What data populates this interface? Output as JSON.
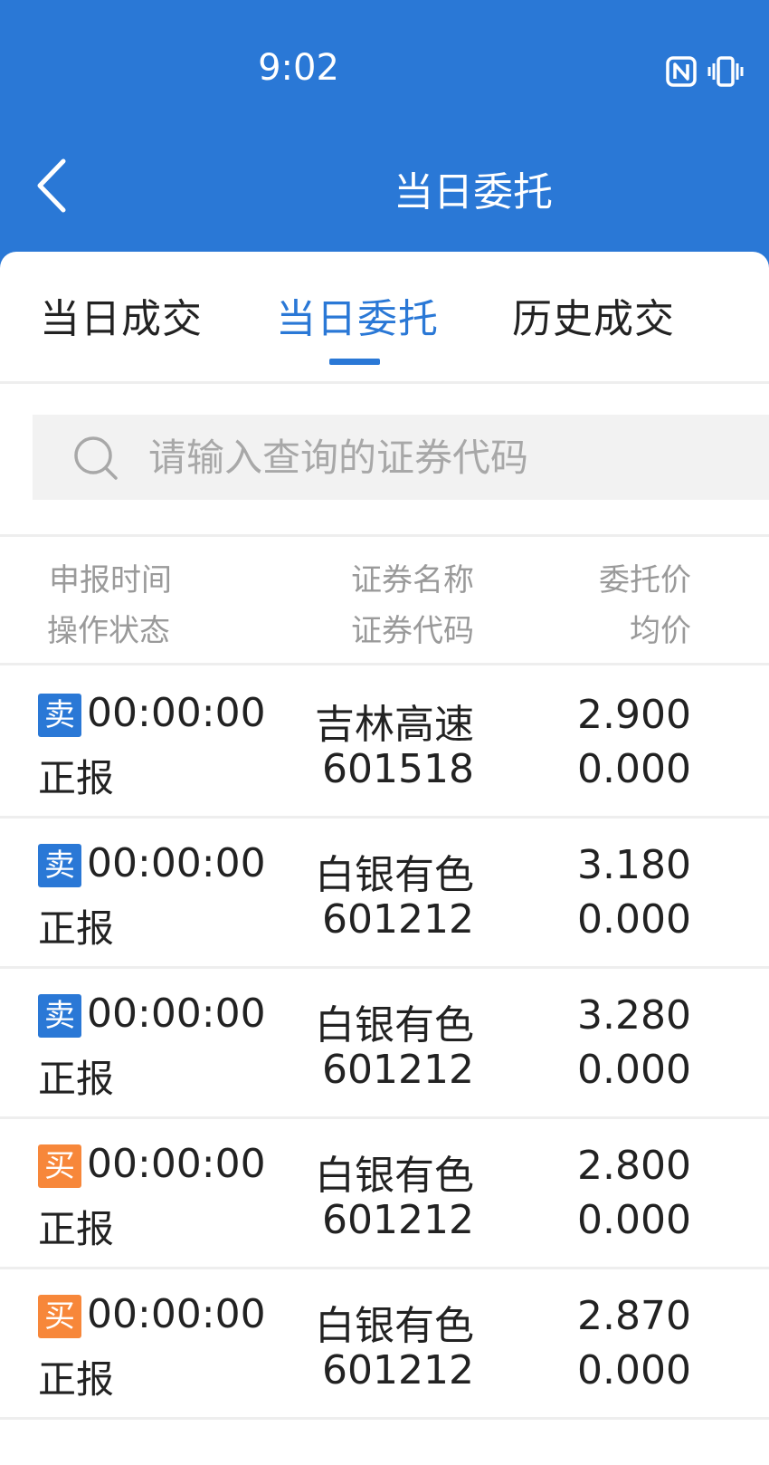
{
  "status_bar": {
    "time": "9:02",
    "icons": [
      "nfc-icon",
      "vibrate-icon"
    ]
  },
  "header": {
    "title": "当日委托",
    "back_icon": "chevron-left-icon"
  },
  "tabs": [
    {
      "label": "当日成交",
      "active": false
    },
    {
      "label": "当日委托",
      "active": true
    },
    {
      "label": "历史成交",
      "active": false
    }
  ],
  "search": {
    "placeholder": "请输入查询的证券代码",
    "value": ""
  },
  "columns": {
    "time": "申报时间",
    "state": "操作状态",
    "name": "证券名称",
    "code": "证券代码",
    "price": "委托价",
    "avg": "均价"
  },
  "orders": [
    {
      "side": "卖",
      "side_type": "sell",
      "time": "00:00:00",
      "state": "正报",
      "name": "吉林高速",
      "code": "601518",
      "price": "2.900",
      "avg": "0.000"
    },
    {
      "side": "卖",
      "side_type": "sell",
      "time": "00:00:00",
      "state": "正报",
      "name": "白银有色",
      "code": "601212",
      "price": "3.180",
      "avg": "0.000"
    },
    {
      "side": "卖",
      "side_type": "sell",
      "time": "00:00:00",
      "state": "正报",
      "name": "白银有色",
      "code": "601212",
      "price": "3.280",
      "avg": "0.000"
    },
    {
      "side": "买",
      "side_type": "buy",
      "time": "00:00:00",
      "state": "正报",
      "name": "白银有色",
      "code": "601212",
      "price": "2.800",
      "avg": "0.000"
    },
    {
      "side": "买",
      "side_type": "buy",
      "time": "00:00:00",
      "state": "正报",
      "name": "白银有色",
      "code": "601212",
      "price": "2.870",
      "avg": "0.000"
    }
  ],
  "colors": {
    "primary": "#2a78d6",
    "buy": "#f7873a",
    "sell": "#2a78d6"
  }
}
